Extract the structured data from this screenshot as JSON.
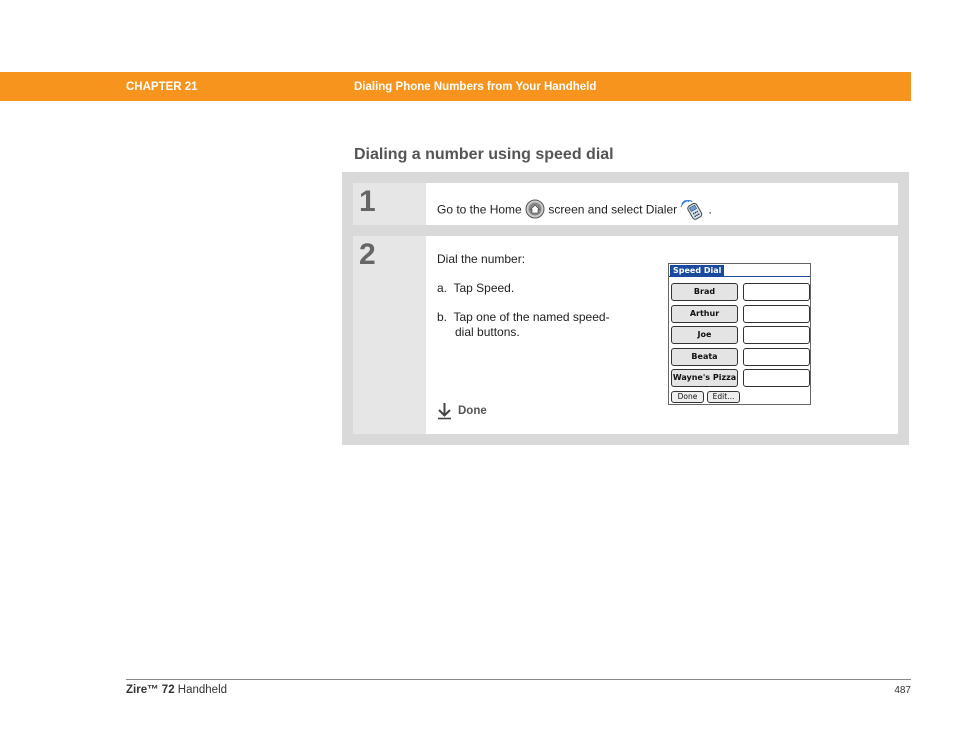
{
  "header": {
    "chapter": "CHAPTER 21",
    "chapter_title": "Dialing Phone Numbers from Your Handheld",
    "bar_color": "#f7941d"
  },
  "section": {
    "title": "Dialing a number using speed dial"
  },
  "steps": [
    {
      "number": "1",
      "text_before": "Go to the Home",
      "text_middle": "screen and select Dialer",
      "text_after": ".",
      "icons": [
        "home-icon",
        "dialer-icon"
      ]
    },
    {
      "number": "2",
      "intro": "Dial the number:",
      "sub_a": "a.  Tap Speed.",
      "sub_b_line1": "b.  Tap one of the named speed-",
      "sub_b_line2": "dial buttons.",
      "done_label": "Done",
      "done_icon": "down-arrow-icon"
    }
  ],
  "speed_dial_screen": {
    "title": "Speed Dial",
    "buttons": [
      "Brad",
      "Arthur",
      "Joe",
      "Beata",
      "Wayne's Pizza"
    ],
    "done_button": "Done",
    "edit_button": "Edit..."
  },
  "footer": {
    "product_prefix": "Zire™",
    "product_model": "72",
    "product_suffix": "Handheld",
    "page_number": "487"
  }
}
